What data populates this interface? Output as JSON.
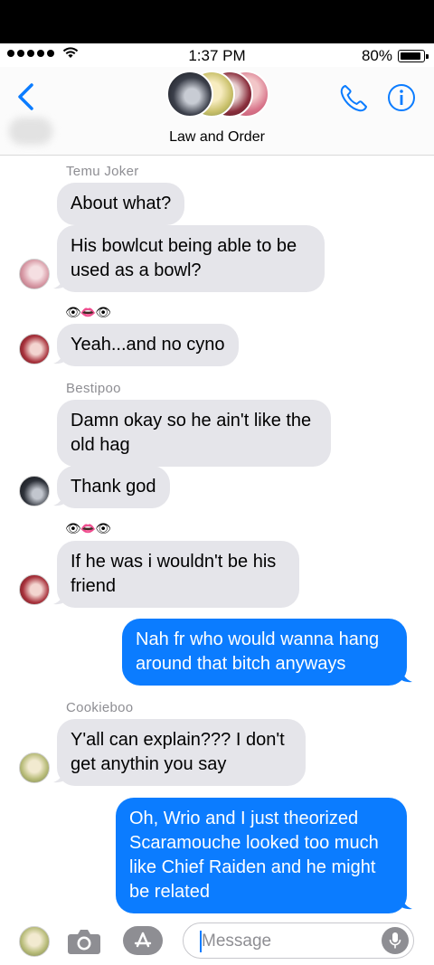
{
  "status_bar": {
    "time": "1:37 PM",
    "battery": "80%"
  },
  "header": {
    "group_name": "Law and Order"
  },
  "messages": [
    {
      "sender": "Temu Joker"
    },
    {
      "text": "About what?"
    },
    {
      "text": "His bowlcut being able to be used as a bowl?"
    },
    {
      "emoji": "👁👄👁"
    },
    {
      "text": "Yeah...and no cyno"
    },
    {
      "sender": "Bestipoo"
    },
    {
      "text": "Damn okay so he ain't like the old hag"
    },
    {
      "text": "Thank god"
    },
    {
      "emoji": "👁👄👁"
    },
    {
      "text": "If he was i wouldn't be his friend"
    },
    {
      "text": "Nah fr who would wanna hang around that bitch anyways"
    },
    {
      "sender": "Cookieboo"
    },
    {
      "text": "Y'all can explain??? I don't get anythin you say"
    },
    {
      "text": "Oh, Wrio and I just theorized Scaramouche looked too much like Chief Raiden and he might be related"
    }
  ],
  "composer": {
    "placeholder": "Message"
  },
  "colors": {
    "accent": "#0b7cff",
    "incoming_bubble": "#e5e5ea",
    "outgoing_bubble": "#0b7cff"
  }
}
